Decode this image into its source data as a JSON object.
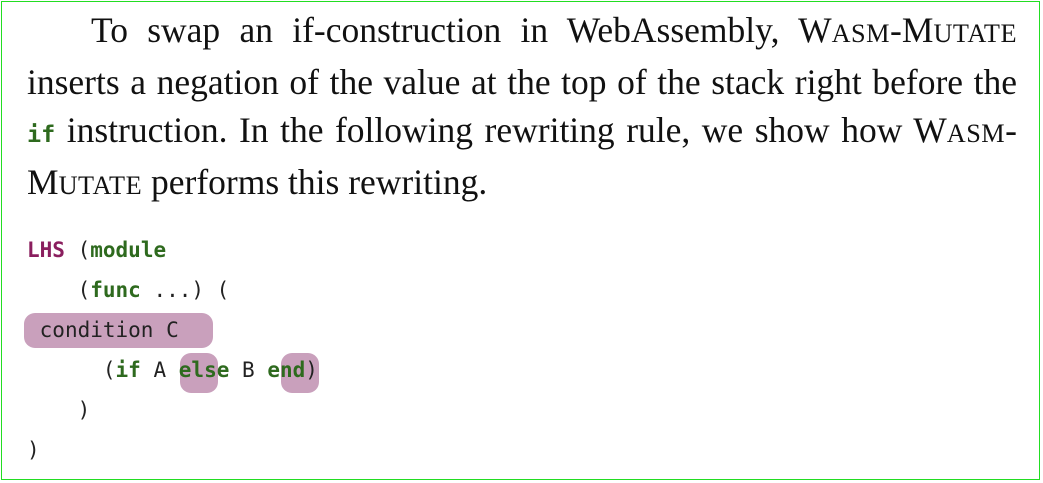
{
  "paragraph": {
    "part1": "To swap an if-construction in WebAssembly, ",
    "tool_a1": "W",
    "tool_a2": "ASM",
    "dash": "-",
    "tool_b1": "M",
    "tool_b2": "UTATE",
    "part2": " inserts a negation of the value at the top of the stack right before the ",
    "code_if": "if",
    "part3": " instruction. In the following rewriting rule, we show how ",
    "tool2_a1": "W",
    "tool2_a2": "ASM",
    "dash2": "-",
    "tool2_b1": "M",
    "tool2_b2": "UTATE",
    "part4": " performs this rewriting."
  },
  "code": {
    "lhs_label": "LHS",
    "open_paren": "(",
    "module_kw": "module",
    "func_open": "(",
    "func_kw": "func",
    "func_rest": " ...) (",
    "condition_text": "condition C",
    "if_open": "(",
    "if_kw": "if",
    "hole_a": "A",
    "else_kw": "else",
    "hole_b": "B",
    "end_kw": "end",
    "if_close": ")",
    "inner_close": ")",
    "outer_close": ")"
  },
  "colors": {
    "frame": "#22dd22",
    "keyword_green": "#2e6a1e",
    "keyword_purple": "#8a1e5e",
    "hole_highlight": "#c9a0bc"
  }
}
